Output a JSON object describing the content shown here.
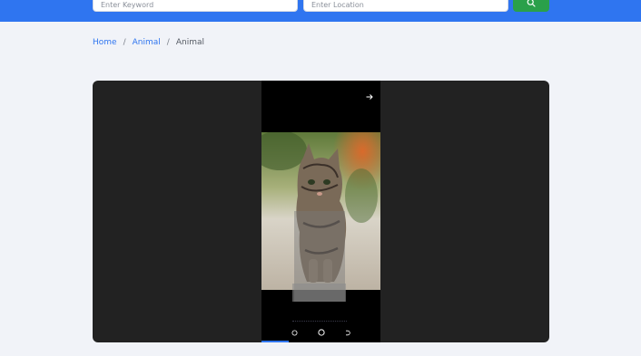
{
  "search": {
    "keyword_placeholder": "Enter Keyword",
    "location_placeholder": "Enter Location",
    "search_icon": "search-icon"
  },
  "breadcrumb": {
    "home": "Home",
    "separator": "/",
    "category": "Animal",
    "current": "Animal"
  },
  "viewer": {
    "image_subject": "kitten photo",
    "next_icon": "arrow-right-icon",
    "nav_icons": [
      "circle-icon",
      "home-circle-icon",
      "back-icon"
    ]
  },
  "colors": {
    "accent": "#2f75f0",
    "search_button": "#2aa04a",
    "viewer_bg": "#222222",
    "page_bg": "#f1f3f8"
  }
}
